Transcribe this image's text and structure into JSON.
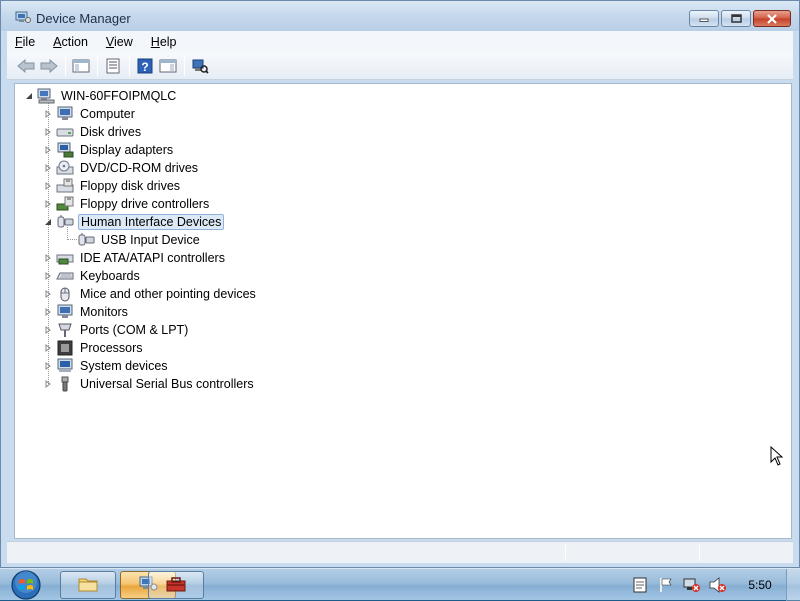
{
  "window": {
    "title": "Device Manager",
    "icon": "device-manager-icon"
  },
  "menubar": {
    "items": [
      {
        "label": "File",
        "mnemonic": "F",
        "rest": "ile"
      },
      {
        "label": "Action",
        "mnemonic": "A",
        "rest": "ction"
      },
      {
        "label": "View",
        "mnemonic": "V",
        "rest": "iew"
      },
      {
        "label": "Help",
        "mnemonic": "H",
        "rest": "elp"
      }
    ]
  },
  "toolbar": {
    "buttons": [
      "back-arrow-icon",
      "forward-arrow-icon",
      "show-hide-console-tree-icon",
      "properties-icon",
      "help-icon",
      "action-pane-icon",
      "scan-hardware-icon"
    ]
  },
  "tree": {
    "root": {
      "label": "WIN-60FFOIPMQLC",
      "icon": "computer-icon",
      "expanded": true
    },
    "categories": [
      {
        "label": "Computer",
        "icon": "monitor-icon",
        "expanded": false
      },
      {
        "label": "Disk drives",
        "icon": "disk-drive-icon",
        "expanded": false
      },
      {
        "label": "Display adapters",
        "icon": "display-adapter-icon",
        "expanded": false
      },
      {
        "label": "DVD/CD-ROM drives",
        "icon": "cd-drive-icon",
        "expanded": false
      },
      {
        "label": "Floppy disk drives",
        "icon": "floppy-drive-icon",
        "expanded": false
      },
      {
        "label": "Floppy drive controllers",
        "icon": "controller-icon",
        "expanded": false
      },
      {
        "label": "Human Interface Devices",
        "icon": "hid-icon",
        "expanded": true,
        "selected": true
      },
      {
        "label": "IDE ATA/ATAPI controllers",
        "icon": "ide-controller-icon",
        "expanded": false
      },
      {
        "label": "Keyboards",
        "icon": "keyboard-icon",
        "expanded": false
      },
      {
        "label": "Mice and other pointing devices",
        "icon": "mouse-icon",
        "expanded": false
      },
      {
        "label": "Monitors",
        "icon": "monitor-icon",
        "expanded": false
      },
      {
        "label": "Ports (COM & LPT)",
        "icon": "port-icon",
        "expanded": false
      },
      {
        "label": "Processors",
        "icon": "processor-icon",
        "expanded": false
      },
      {
        "label": "System devices",
        "icon": "system-device-icon",
        "expanded": false
      },
      {
        "label": "Universal Serial Bus controllers",
        "icon": "usb-icon",
        "expanded": false
      }
    ],
    "hid_children": [
      {
        "label": "USB Input Device",
        "icon": "hid-icon"
      }
    ]
  },
  "taskbar": {
    "buttons": [
      {
        "name": "explorer",
        "icon": "folder-icon",
        "active": false
      },
      {
        "name": "device-manager",
        "icon": "device-manager-icon",
        "active": true
      },
      {
        "name": "toolbox",
        "icon": "toolbox-icon",
        "active": false
      }
    ],
    "tray_icons": [
      "notes-icon",
      "action-center-flag-icon",
      "network-icon",
      "volume-muted-icon"
    ],
    "clock": "5:50"
  },
  "colors": {
    "selection_bg": "#dde9f6",
    "selection_border": "#92b3d8",
    "title_bg": "#c5d8ec"
  }
}
